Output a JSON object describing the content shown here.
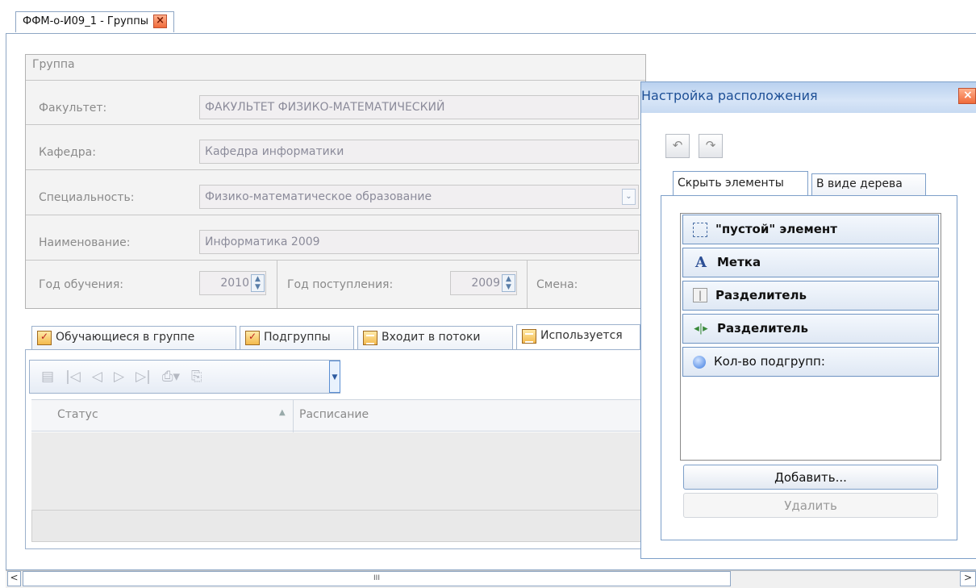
{
  "document_tab": {
    "title": "ФФМ-о-И09_1 - Группы",
    "close": "x"
  },
  "group": {
    "title": "Группа",
    "fields": {
      "faculty_label": "Факультет:",
      "faculty_value": "ФАКУЛЬТЕТ ФИЗИКО-МАТЕМАТИЧЕСКИЙ",
      "department_label": "Кафедра:",
      "department_value": "Кафедра информатики",
      "specialty_label": "Специальность:",
      "specialty_value": "Физико-математическое образование",
      "name_label": "Наименование:",
      "name_value": "Информатика 2009",
      "study_year_label": "Год обучения:",
      "study_year_value": "2010",
      "admission_year_label": "Год поступления:",
      "admission_year_value": "2009",
      "shift_label": "Смена:"
    }
  },
  "tabs": [
    {
      "label": "Обучающиеся в группе"
    },
    {
      "label": "Подгруппы"
    },
    {
      "label": "Входит в потоки"
    },
    {
      "label": "Используется"
    }
  ],
  "grid": {
    "columns": [
      "Статус",
      "Расписание"
    ]
  },
  "scrollbar": {
    "thumb": "III"
  },
  "layout_panel": {
    "title": "Настройка расположения",
    "tabs": [
      "Скрыть элементы",
      "В виде дерева"
    ],
    "items": [
      {
        "icon": "empty-element-icon",
        "label": "\"пустой\" элемент"
      },
      {
        "icon": "label-a-icon",
        "label": "Метка"
      },
      {
        "icon": "separator-icon",
        "label": "Разделитель"
      },
      {
        "icon": "splitter-icon",
        "label": "Разделитель"
      },
      {
        "icon": "spin-field-icon",
        "label": "Кол-во подгрупп:"
      }
    ],
    "add_button": "Добавить...",
    "delete_button": "Удалить"
  }
}
